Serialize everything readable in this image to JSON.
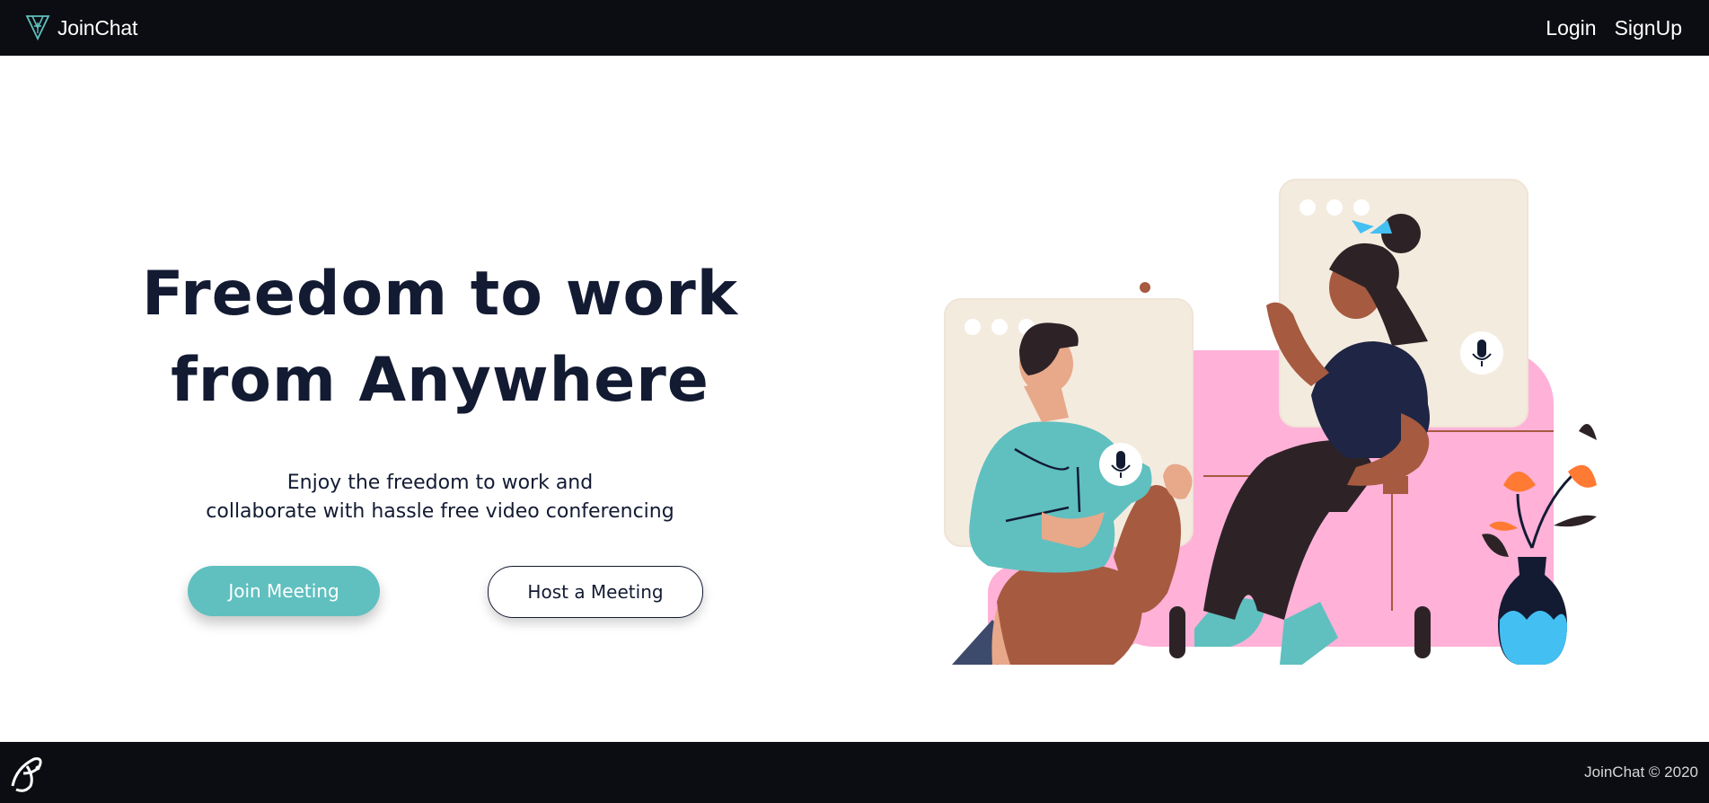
{
  "nav": {
    "brand_name": "JoinChat",
    "links": [
      {
        "label": "Login"
      },
      {
        "label": "SignUp"
      }
    ]
  },
  "hero": {
    "title_line1": "Freedom to work",
    "title_line2": "from Anywhere",
    "subtitle_line1": "Enjoy the freedom to work and",
    "subtitle_line2": "collaborate with hassle free video conferencing",
    "join_button": "Join Meeting",
    "host_button": "Host a Meeting"
  },
  "footer": {
    "copyright": "JoinChat © 2020"
  },
  "colors": {
    "bar_background": "#0b0d12",
    "accent_teal": "#5fc0bf",
    "text_dark": "#131b33",
    "sofa_pink": "#ffb1d8"
  },
  "icons": [
    "joinchat-logo-icon",
    "footer-logo-icon",
    "microphone-icon"
  ]
}
